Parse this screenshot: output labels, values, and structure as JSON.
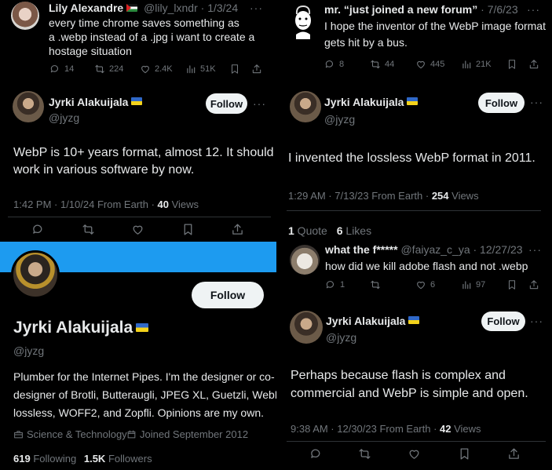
{
  "tl": {
    "tweet": {
      "author": "Lily Alexandre",
      "handle_date": "@lily_lxndr · 1/3/24",
      "lines": [
        "every time chrome saves something as",
        "a .webp instead of a .jpg i want to create a",
        "hostage situation"
      ],
      "replies": "14",
      "retweets": "224",
      "likes": "2.4K",
      "views": "51K"
    },
    "reply": {
      "author": "Jyrki Alakuijala",
      "handle": "@jyzg",
      "follow_label": "Follow",
      "lines": [
        "WebP is 10+ years format, almost 12. It should",
        "work in various software by now."
      ],
      "meta_prefix": "1:42 PM · 1/10/24 From Earth · ",
      "views_count": "40",
      "views_label": " Views"
    }
  },
  "bl": {
    "author": "Jyrki Alakuijala",
    "handle": "@jyzg",
    "follow_label": "Follow",
    "bio_lines": [
      "Plumber for the Internet Pipes. I'm the designer or co-",
      "designer of Brotli, Butteraugli, JPEG XL, Guetzli, WebP",
      "lossless, WOFF2, and Zopfli. Opinions are my own."
    ],
    "category": "Science & Technology",
    "joined": "Joined September 2012",
    "following_count": "619",
    "following_label": " Following",
    "followers_count": "1.5K",
    "followers_label": " Followers"
  },
  "tr": {
    "tweet": {
      "author": "mr. “just joined a new forum”",
      "date": " · 7/6/23",
      "lines": [
        "I hope the inventor of the WebP image format",
        "gets hit by a bus."
      ],
      "replies": "8",
      "retweets": "44",
      "likes": "445",
      "views": "21K"
    },
    "reply": {
      "author": "Jyrki Alakuijala",
      "handle": "@jyzg",
      "follow_label": "Follow",
      "text": "I invented the lossless WebP format in 2011.",
      "meta_prefix": "1:29 AM · 7/13/23 From Earth · ",
      "views_count": "254",
      "views_label": " Views"
    }
  },
  "br": {
    "quote_count": "1",
    "quote_label": " Quote",
    "likes_count": "6",
    "likes_label": " Likes",
    "tweet": {
      "author": "what the f*****",
      "handle_date": " @faiyaz_c_ya · 12/27/23",
      "text": "how did we kill adobe flash and not .webp",
      "replies": "1",
      "likes": "6",
      "views": "97"
    },
    "reply": {
      "author": "Jyrki Alakuijala",
      "handle": "@jyzg",
      "follow_label": "Follow",
      "lines": [
        "Perhaps because flash is complex and",
        "commercial and WebP is simple and open."
      ],
      "meta_prefix": "9:38 AM · 12/30/23 From Earth · ",
      "views_count": "42",
      "views_label": " Views"
    }
  },
  "colors": {
    "background": "#000000",
    "text": "#e7e9ea",
    "muted": "#71767b",
    "banner": "#1d9bf0",
    "follow_bg": "#eff3f4"
  },
  "icons": [
    "reply-icon",
    "retweet-icon",
    "like-icon",
    "views-icon",
    "bookmark-icon",
    "share-icon",
    "more-icon",
    "briefcase-icon",
    "calendar-icon"
  ]
}
